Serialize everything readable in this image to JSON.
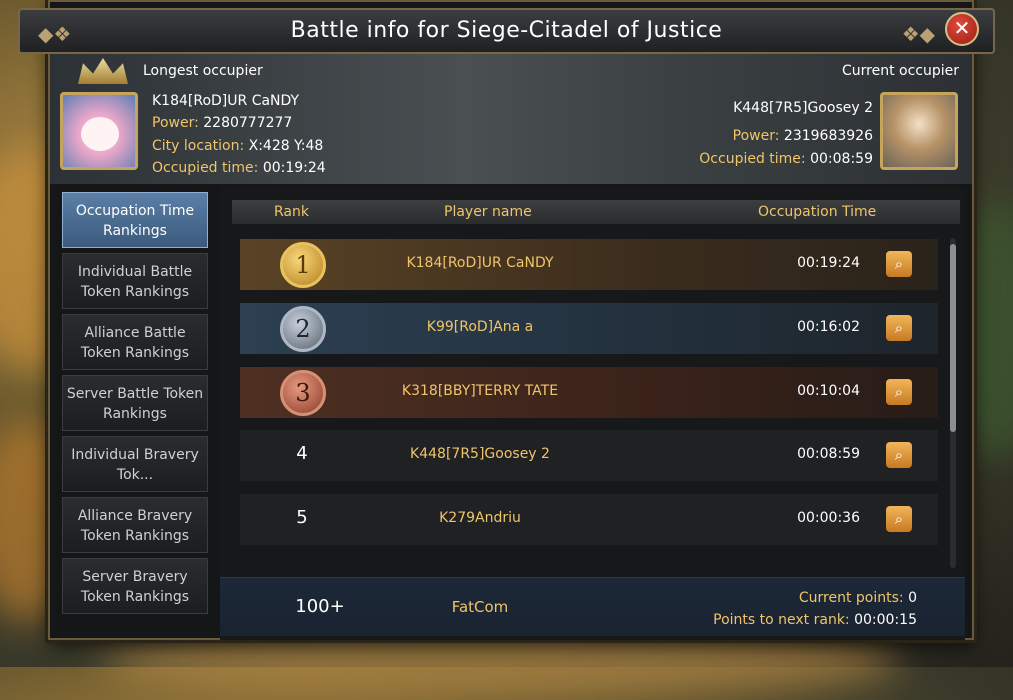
{
  "window": {
    "title": "Battle info for Siege-Citadel of Justice"
  },
  "longest": {
    "label": "Longest occupier",
    "name": "K184[RoD]UR CaNDY",
    "power_label": "Power:",
    "power": "2280777277",
    "location_label": "City location:",
    "location": "X:428 Y:48",
    "time_label": "Occupied time:",
    "time": "00:19:24"
  },
  "current": {
    "label": "Current occupier",
    "name": "K448[7R5]Goosey 2",
    "power_label": "Power:",
    "power": "2319683926",
    "time_label": "Occupied time:",
    "time": "00:08:59"
  },
  "sidebar": [
    {
      "label": "Occupation Time Rankings",
      "active": true
    },
    {
      "label": "Individual Battle Token Rankings"
    },
    {
      "label": "Alliance Battle Token Rankings"
    },
    {
      "label": "Server Battle Token Rankings"
    },
    {
      "label": "Individual Bravery Tok..."
    },
    {
      "label": "Alliance Bravery Token Rankings"
    },
    {
      "label": "Server Bravery Token Rankings"
    }
  ],
  "table": {
    "headers": {
      "rank": "Rank",
      "player": "Player name",
      "time": "Occupation Time"
    },
    "rows": [
      {
        "rank": "1",
        "name": "K184[RoD]UR CaNDY",
        "time": "00:19:24"
      },
      {
        "rank": "2",
        "name": "K99[RoD]Ana a",
        "time": "00:16:02"
      },
      {
        "rank": "3",
        "name": "K318[BBY]TERRY TATE",
        "time": "00:10:04"
      },
      {
        "rank": "4",
        "name": "K448[7R5]Goosey 2",
        "time": "00:08:59"
      },
      {
        "rank": "5",
        "name": "K279Andriu",
        "time": "00:00:36"
      }
    ]
  },
  "footer": {
    "rank": "100+",
    "name": "FatCom",
    "current_points_label": "Current points:",
    "current_points": "0",
    "next_rank_label": "Points to next rank:",
    "next_rank": "00:00:15"
  },
  "icons": {
    "close": "close-icon",
    "search": "magnifier-icon",
    "crown": "crown-icon"
  },
  "colors": {
    "accent_gold": "#f0c46a",
    "active_tab": "#5b7fa6",
    "close_red": "#c0342a"
  }
}
